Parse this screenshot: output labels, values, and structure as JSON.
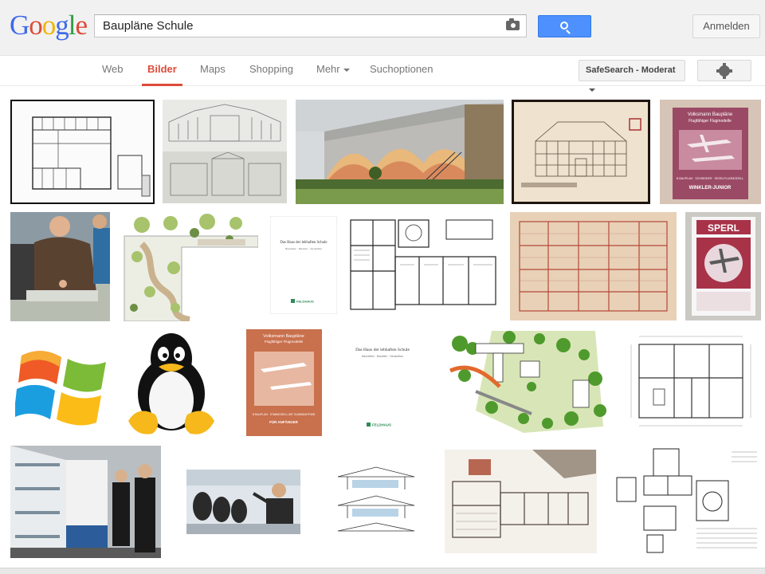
{
  "logo": "Google",
  "search": {
    "value": "Baupläne Schule"
  },
  "signin_label": "Anmelden",
  "nav": {
    "tabs": [
      "Web",
      "Bilder",
      "Maps",
      "Shopping",
      "Mehr",
      "Suchoptionen"
    ],
    "active": "Bilder",
    "safesearch": "SafeSearch - Moderat"
  },
  "colors": {
    "active_tab": "#dd4b39",
    "search_button": "#4d90fe"
  },
  "icons": [
    "camera-icon",
    "search-icon",
    "gear-icon"
  ],
  "results": {
    "doc_caption": "Das Haus der lebhaften Schule",
    "doc_sub": "Baustellen · Bauleiter · Neuaufbau",
    "publisher": "FELDHAUS",
    "poster_1_title": "Volksmann Baupläne",
    "poster_1_sub": "Flugfähiger Flugmodelle",
    "poster_1_line": "B BAUPLAN · SCHNEIDER · SEGELFLUGMODELL",
    "poster_1_name": "WINKLER-JUNIOR",
    "poster_2_title": "SPERL",
    "poster_3_title": "Volksmann Baupläne",
    "poster_3_sub": "Flugfähiger Flugmodelle",
    "poster_3_line": "B BAUPLAN · STABMODELL MIT GUMMIANTRIEB",
    "poster_3_name": "FÜR ANFÄNGER"
  }
}
